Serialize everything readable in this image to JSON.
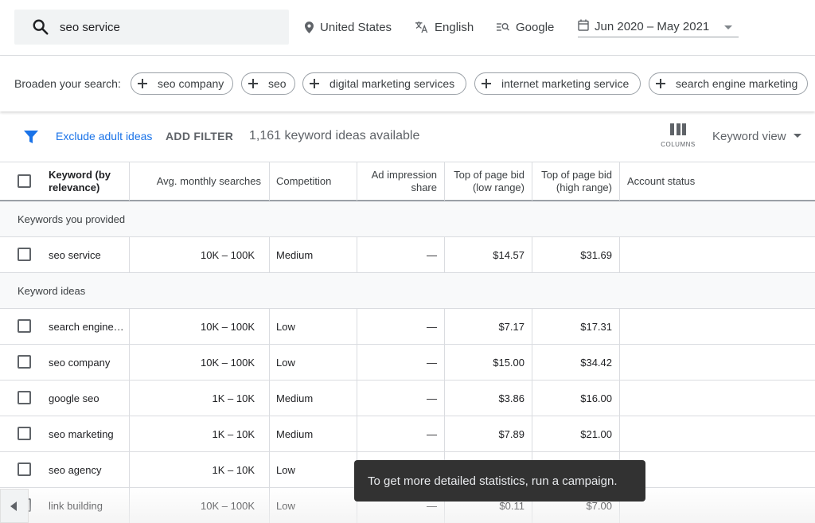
{
  "search": {
    "query": "seo service"
  },
  "targeting": {
    "location": "United States",
    "language": "English",
    "network": "Google",
    "date_range": "Jun 2020 – May 2021"
  },
  "broaden": {
    "label": "Broaden your search:",
    "chips": [
      "seo company",
      "seo",
      "digital marketing services",
      "internet marketing service",
      "search engine marketing"
    ]
  },
  "toolbar": {
    "exclude_adult": "Exclude adult ideas",
    "add_filter": "ADD FILTER",
    "available": "1,161 keyword ideas available",
    "columns_label": "COLUMNS",
    "view": "Keyword view"
  },
  "table": {
    "headers": {
      "keyword_l1": "Keyword (by",
      "keyword_l2": "relevance)",
      "avg": "Avg. monthly searches",
      "competition": "Competition",
      "ad_l1": "Ad impression",
      "ad_l2": "share",
      "low_l1": "Top of page bid",
      "low_l2": "(low range)",
      "high_l1": "Top of page bid",
      "high_l2": "(high range)",
      "status": "Account status"
    },
    "section_provided": "Keywords you provided",
    "section_ideas": "Keyword ideas",
    "provided": [
      {
        "keyword": "seo service",
        "avg": "10K – 100K",
        "competition": "Medium",
        "ad_share": "—",
        "low": "$14.57",
        "high": "$31.69"
      }
    ],
    "ideas": [
      {
        "keyword": "search engine…",
        "avg": "10K – 100K",
        "competition": "Low",
        "ad_share": "—",
        "low": "$7.17",
        "high": "$17.31"
      },
      {
        "keyword": "seo company",
        "avg": "10K – 100K",
        "competition": "Low",
        "ad_share": "—",
        "low": "$15.00",
        "high": "$34.42"
      },
      {
        "keyword": "google seo",
        "avg": "1K – 10K",
        "competition": "Medium",
        "ad_share": "—",
        "low": "$3.86",
        "high": "$16.00"
      },
      {
        "keyword": "seo marketing",
        "avg": "1K – 10K",
        "competition": "Medium",
        "ad_share": "—",
        "low": "$7.89",
        "high": "$21.00"
      },
      {
        "keyword": "seo agency",
        "avg": "1K – 10K",
        "competition": "Low",
        "ad_share": "",
        "low": "",
        "high": ""
      },
      {
        "keyword": "link building",
        "avg": "10K – 100K",
        "competition": "Low",
        "ad_share": "—",
        "low": "$0.11",
        "high": "$7.00"
      }
    ]
  },
  "toast": "To get more detailed statistics, run a campaign."
}
